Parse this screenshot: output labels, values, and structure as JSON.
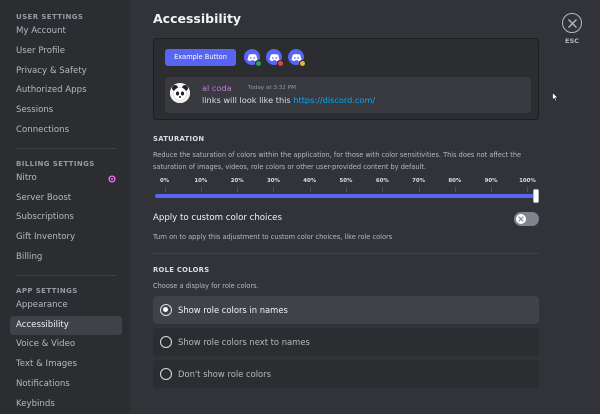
{
  "sidebar": {
    "user_settings_header": "USER SETTINGS",
    "user_items": [
      "My Account",
      "User Profile",
      "Privacy & Safety",
      "Authorized Apps",
      "Sessions",
      "Connections"
    ],
    "billing_header": "BILLING SETTINGS",
    "billing_items": [
      "Nitro",
      "Server Boost",
      "Subscriptions",
      "Gift Inventory",
      "Billing"
    ],
    "app_header": "APP SETTINGS",
    "app_items": [
      "Appearance",
      "Accessibility",
      "Voice & Video",
      "Text & Images",
      "Notifications",
      "Keybinds"
    ],
    "active_item": "Accessibility"
  },
  "page": {
    "title": "Accessibility",
    "esc_label": "ESC"
  },
  "preview": {
    "example_button": "Example Button",
    "message": {
      "username": "al coda",
      "timestamp": "Today at 3:32 PM",
      "text": "links will look like this ",
      "link": "https://discord.com/"
    }
  },
  "saturation": {
    "title": "SATURATION",
    "description": "Reduce the saturation of colors within the application, for those with color sensitivities. This does not affect the saturation of images, videos, role colors or other user-provided content by default.",
    "labels": [
      "0%",
      "10%",
      "20%",
      "30%",
      "40%",
      "50%",
      "60%",
      "70%",
      "80%",
      "90%",
      "100%"
    ],
    "value_percent": 100
  },
  "custom_colors": {
    "label": "Apply to custom color choices",
    "description": "Turn on to apply this adjustment to custom color choices, like role colors",
    "enabled": false
  },
  "role_colors": {
    "title": "ROLE COLORS",
    "description": "Choose a display for role colors.",
    "options": [
      "Show role colors in names",
      "Show role colors next to names",
      "Don't show role colors"
    ],
    "selected_index": 0
  },
  "colors": {
    "accent": "#5865f2",
    "link": "#00a8fc",
    "username": "#c57ad8",
    "status_online": "#23a55a",
    "status_dnd": "#f23f43",
    "status_idle": "#f0b232",
    "nitro_pink": "#ff73fa"
  }
}
